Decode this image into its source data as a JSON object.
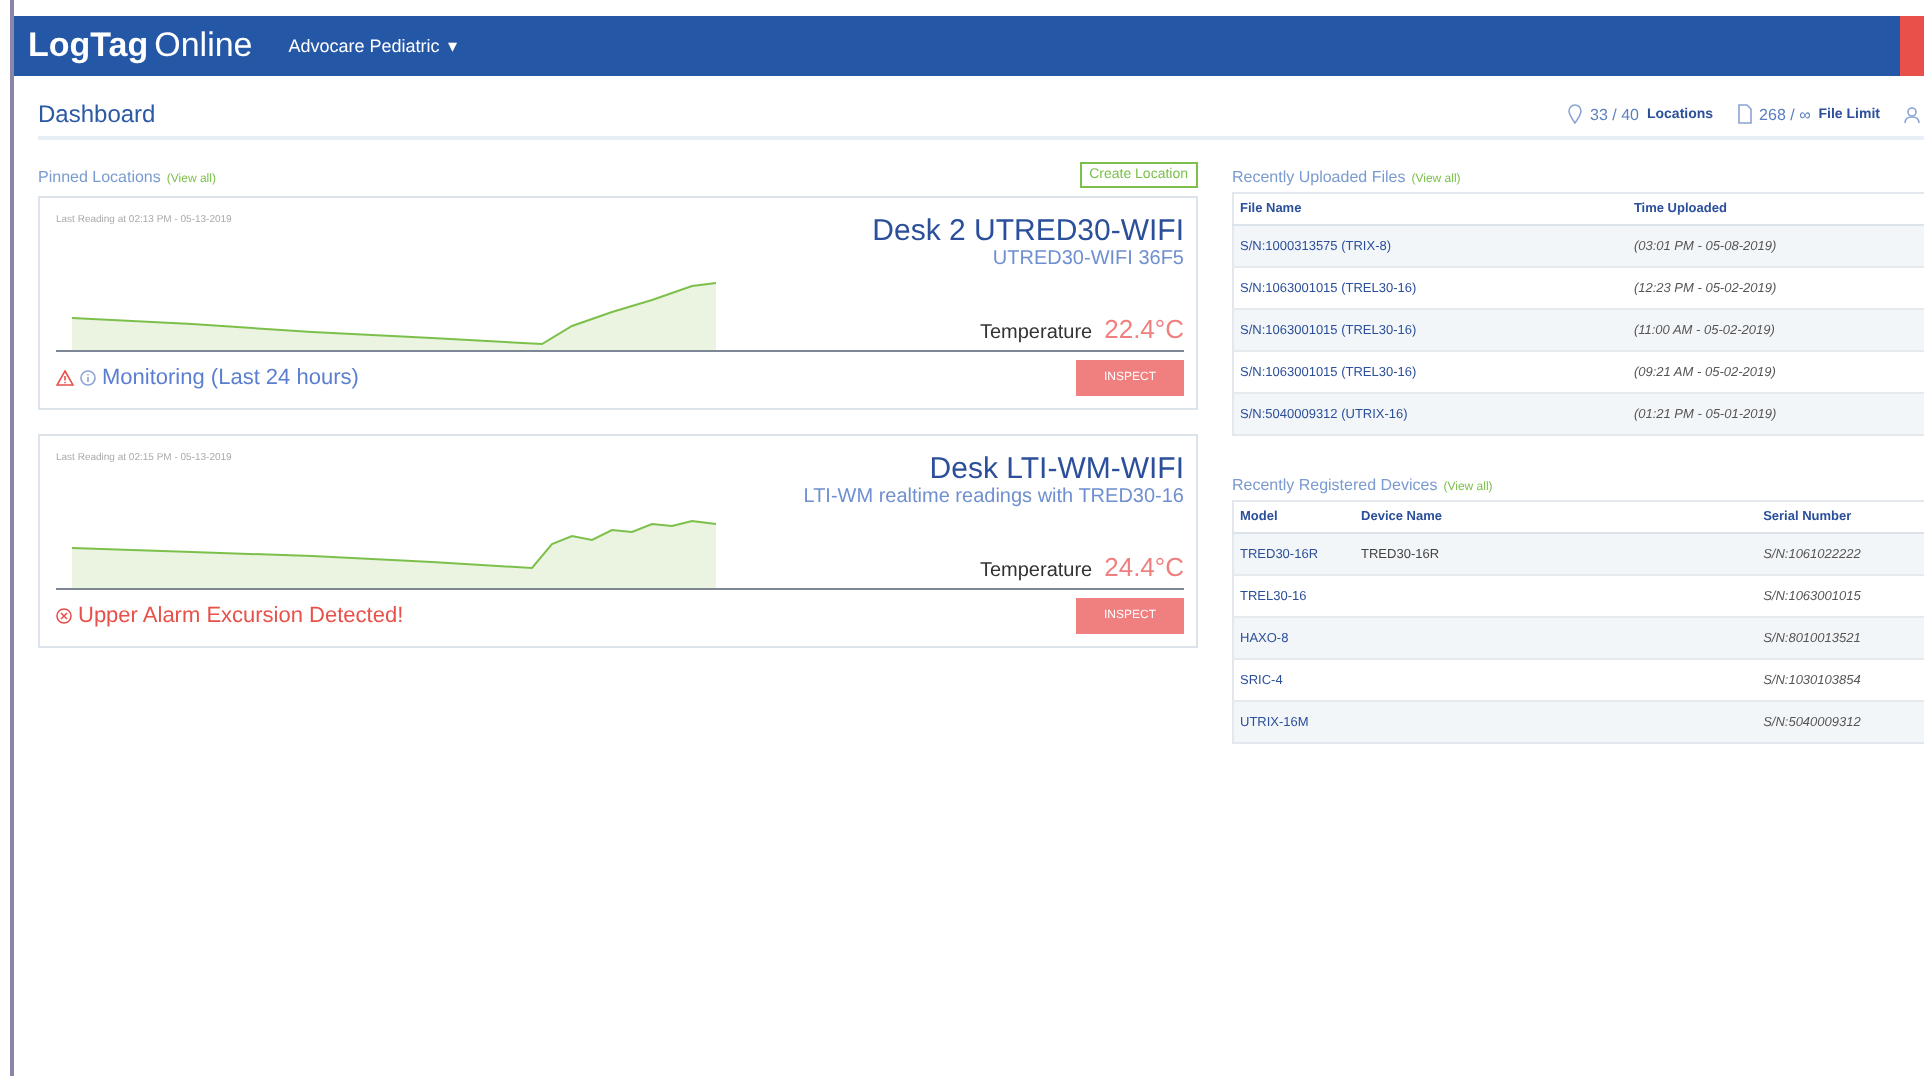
{
  "header": {
    "logo_bold": "LogTag",
    "logo_light": "Online",
    "account": "Advocare Pediatric",
    "account_caret": "▾"
  },
  "page_title": "Dashboard",
  "stats": [
    {
      "kind": "locations",
      "value": "33 / 40",
      "label": "Locations"
    },
    {
      "kind": "files",
      "value": "268 / ∞",
      "label": "File Limit"
    }
  ],
  "pinned": {
    "title": "Pinned Locations",
    "view_all": "(View all)",
    "create_button": "Create Location",
    "cards": [
      {
        "kind": "monitoring",
        "last_reading": "Last Reading at 02:13 PM - 05-13-2019",
        "name": "Desk 2 UTRED30-WIFI",
        "subtitle": "UTRED30-WIFI 36F5",
        "reading_label": "Temperature",
        "reading": "22.4°C",
        "status": "Monitoring (Last 24 hours)",
        "button": "INSPECT"
      },
      {
        "kind": "alarm",
        "last_reading": "Last Reading at 02:15 PM - 05-13-2019",
        "name": "Desk LTI-WM-WIFI",
        "subtitle": "LTI-WM realtime readings with TRED30-16",
        "reading_label": "Temperature",
        "reading": "24.4°C",
        "status": "Upper Alarm Excursion Detected!",
        "button": "INSPECT"
      }
    ]
  },
  "files": {
    "title": "Recently Uploaded Files",
    "view_all": "(View all)",
    "columns": [
      "File Name",
      "Time Uploaded"
    ],
    "rows": [
      [
        "S/N:1000313575 (TRIX-8)",
        "(03:01 PM - 05-08-2019)"
      ],
      [
        "S/N:1063001015 (TREL30-16)",
        "(12:23 PM - 05-02-2019)"
      ],
      [
        "S/N:1063001015 (TREL30-16)",
        "(11:00 AM - 05-02-2019)"
      ],
      [
        "S/N:1063001015 (TREL30-16)",
        "(09:21 AM - 05-02-2019)"
      ],
      [
        "S/N:5040009312 (UTRIX-16)",
        "(01:21 PM - 05-01-2019)"
      ]
    ]
  },
  "devices": {
    "title": "Recently Registered Devices",
    "view_all": "(View all)",
    "columns": [
      "Model",
      "Device Name",
      "Serial Number"
    ],
    "rows": [
      [
        "TRED30-16R",
        "TRED30-16R",
        "S/N:1061022222"
      ],
      [
        "TREL30-16",
        "",
        "S/N:1063001015"
      ],
      [
        "HAXO-8",
        "",
        "S/N:8010013521"
      ],
      [
        "SRIC-4",
        "",
        "S/N:1030103854"
      ],
      [
        "UTRIX-16M",
        "",
        "S/N:5040009312"
      ]
    ]
  }
}
